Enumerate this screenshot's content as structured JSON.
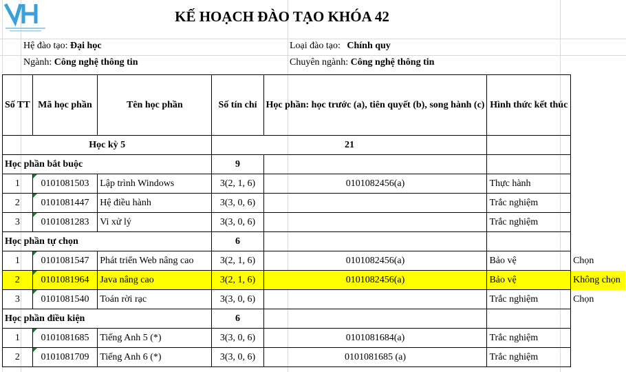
{
  "title": "KẾ HOẠCH ĐÀO TẠO KHÓA 42",
  "logo": {
    "icon": "university-logo-icon",
    "color": "#3aa0d8"
  },
  "info": {
    "he_label": "Hệ đào tạo:",
    "he_value": "Đại học",
    "loai_label": "Loại đào tạo:",
    "loai_value": "Chính quy",
    "nganh_label": "Ngành:",
    "nganh_value": "Công nghệ thông tin",
    "chuyen_label": "Chuyên ngành:",
    "chuyen_value": "Công nghệ thông tin"
  },
  "headers": {
    "stt": "Số TT",
    "ma": "Mã học phần",
    "ten": "Tên học phần",
    "tinchi": "Số tín chỉ",
    "hocphan": "Học phần: học trước (a), tiên quyết (b), song hành (c)",
    "hinhthuc": "Hình thức kết thúc"
  },
  "semester": {
    "label": "Học kỳ 5",
    "credits": "21"
  },
  "sections": [
    {
      "label": "Học phần bắt buộc",
      "credits": "9",
      "rows": [
        {
          "stt": "1",
          "ma": "0101081503",
          "ten": "Lập trình Windows",
          "tinchi": "3(2, 1, 6)",
          "hp": "0101082456(a)",
          "ht": "Thực hành",
          "note": ""
        },
        {
          "stt": "2",
          "ma": "0101081447",
          "ten": "Hệ điều hành",
          "tinchi": "3(3, 0, 6)",
          "hp": "",
          "ht": "Trắc nghiệm",
          "note": ""
        },
        {
          "stt": "3",
          "ma": "0101081283",
          "ten": "Vi xử lý",
          "tinchi": "3(3, 0, 6)",
          "hp": "",
          "ht": "Trắc nghiệm",
          "note": ""
        }
      ]
    },
    {
      "label": "Học phần tự chọn",
      "credits": "6",
      "rows": [
        {
          "stt": "1",
          "ma": "0101081547",
          "ten": "Phát triển Web nâng cao",
          "tinchi": "3(2, 1, 6)",
          "hp": "0101082456(a)",
          "ht": "Bảo vệ",
          "note": "Chọn"
        },
        {
          "stt": "2",
          "ma": "0101081964",
          "ten": "Java nâng cao",
          "tinchi": "3(2, 1, 6)",
          "hp": "0101082456(a)",
          "ht": "Bảo vệ",
          "note": "Không chọn"
        },
        {
          "stt": "3",
          "ma": "0101081540",
          "ten": "Toán rời rạc",
          "tinchi": "3(3, 0, 6)",
          "hp": "",
          "ht": "Trắc nghiệm",
          "note": "Chọn"
        }
      ]
    },
    {
      "label": "Học phần điều kiện",
      "credits": "6",
      "rows": [
        {
          "stt": "1",
          "ma": "0101081685",
          "ten": "Tiếng Anh 5 (*)",
          "tinchi": "3(3, 0, 6)",
          "hp": "0101081684(a)",
          "ht": "Trắc nghiệm",
          "note": ""
        },
        {
          "stt": "2",
          "ma": "0101081709",
          "ten": "Tiếng Anh 6 (*)",
          "tinchi": "3(3, 0, 6)",
          "hp": "0101081685 (a)",
          "ht": "Trắc nghiệm",
          "note": ""
        }
      ]
    }
  ],
  "highlight_color": "#ffff00"
}
